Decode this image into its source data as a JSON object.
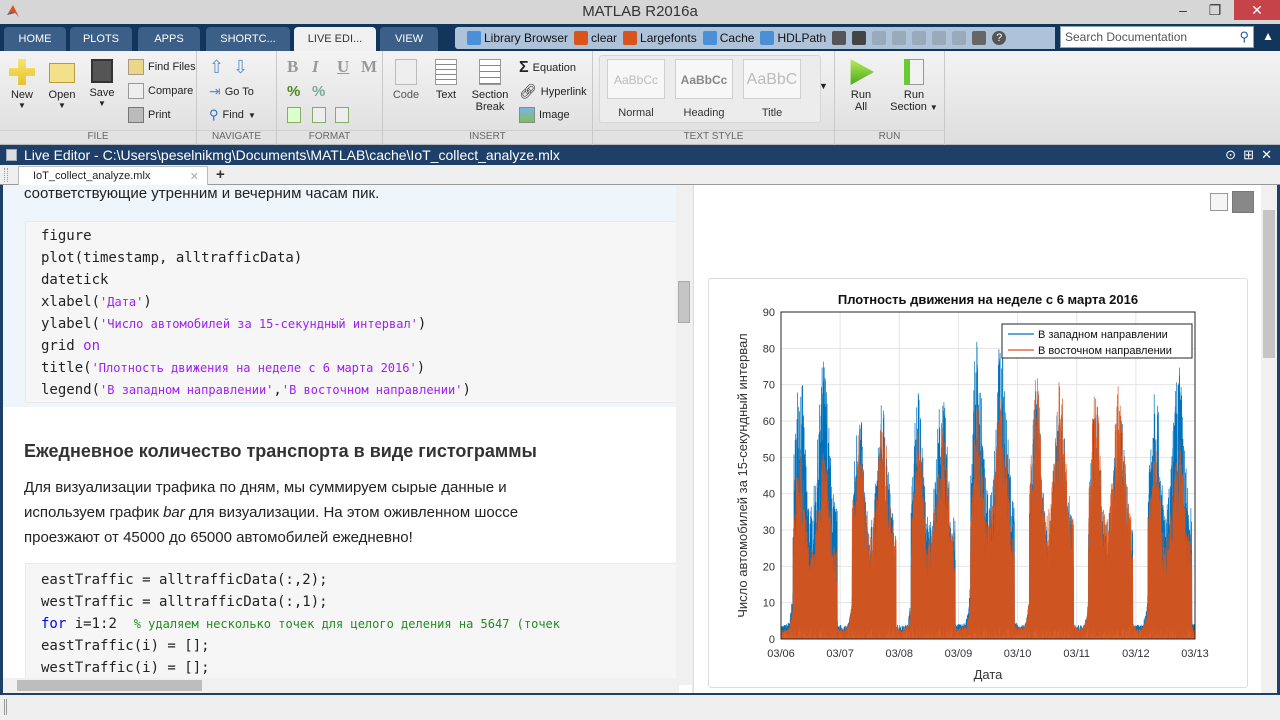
{
  "window": {
    "title": "MATLAB R2016a",
    "minimize": "‒",
    "restore": "❐",
    "close": "✕"
  },
  "tabs": [
    {
      "label": "HOME",
      "active": false
    },
    {
      "label": "PLOTS",
      "active": false
    },
    {
      "label": "APPS",
      "active": false
    },
    {
      "label": "SHORTC...",
      "active": false
    },
    {
      "label": "LIVE EDI...",
      "active": true
    },
    {
      "label": "VIEW",
      "active": false
    }
  ],
  "quick_access": {
    "shortcuts": [
      "Library Browser",
      "clear",
      "Largefonts",
      "Cache",
      "HDLPath"
    ],
    "icons": [
      "new-shortcut-icon",
      "save-icon",
      "cut-icon",
      "copy-icon",
      "paste-icon",
      "undo-icon",
      "redo-icon",
      "switch-windows-icon",
      "help-icon"
    ]
  },
  "search": {
    "placeholder": "Search Documentation"
  },
  "ribbon": {
    "file": {
      "label": "FILE",
      "new": "New",
      "open": "Open",
      "save": "Save",
      "find_files": "Find Files",
      "compare": "Compare",
      "print": "Print"
    },
    "navigate": {
      "label": "NAVIGATE",
      "goto": "Go To",
      "find": "Find"
    },
    "format": {
      "label": "FORMAT",
      "bold": "B",
      "italic": "I",
      "underline": "U",
      "mono": "M"
    },
    "insert": {
      "label": "INSERT",
      "code": "Code",
      "text": "Text",
      "section_break_1": "Section",
      "section_break_2": "Break",
      "equation": "Equation",
      "hyperlink": "Hyperlink",
      "image": "Image"
    },
    "text_style": {
      "label": "TEXT STYLE",
      "styles": [
        {
          "name": "Normal",
          "preview": "AaBbCc"
        },
        {
          "name": "Heading",
          "preview": "AaBbCc"
        },
        {
          "name": "Title",
          "preview": "AaBbC"
        }
      ]
    },
    "run": {
      "label": "RUN",
      "run_all_1": "Run",
      "run_all_2": "All",
      "run_section_1": "Run",
      "run_section_2": "Section"
    }
  },
  "panel": {
    "title": "Live Editor - C:\\Users\\peselnikmg\\Documents\\MATLAB\\cache\\IoT_collect_analyze.mlx"
  },
  "doc_tab": {
    "label": "IoT_collect_analyze.mlx",
    "close": "✕",
    "add": "+"
  },
  "editor": {
    "intro_text": "соответствующие утренним и вечерним часам пик.",
    "code1": {
      "l1": "figure",
      "l2": "plot(timestamp, alltrafficData)",
      "l3": "datetick",
      "l4a": "xlabel(",
      "l4s": "'Дата'",
      "l4b": ")",
      "l5a": "ylabel(",
      "l5s": "'Число автомобилей за 15-секундный интервал'",
      "l5b": ")",
      "l6a": "grid ",
      "l6k": "on",
      "l7a": "title(",
      "l7s": "'Плотность движения на неделе с 6 марта 2016'",
      "l7b": ")",
      "l8a": "legend(",
      "l8s1": "'В западном направлении'",
      "l8c": ",",
      "l8s2": "'В восточном направлении'",
      "l8b": ")"
    },
    "heading": "Ежедневное количество транспорта в виде гистограммы",
    "para1": "Для визуализации трафика по дням, мы суммируем сырые данные и",
    "para2a": "используем график ",
    "para2i": "bar",
    "para2b": " для визуализации. На этом оживленном шоссе",
    "para3": "проезжают от 45000 до 65000 автомобилей ежедневно!",
    "code2": {
      "l1": "eastTraffic = alltrafficData(:,2);",
      "l2": "westTraffic = alltrafficData(:,1);",
      "l3k": "for",
      "l3a": " i=1:2  ",
      "l3c": "% удаляем несколько точек для целого деления на 5647 (точек",
      "l4": "eastTraffic(i) = [];",
      "l5": "westTraffic(i) = [];"
    }
  },
  "chart_data": {
    "type": "line",
    "title": "Плотность движения на неделе с 6 марта 2016",
    "xlabel": "Дата",
    "ylabel": "Число автомобилей за 15-секундный интервал",
    "x_ticks": [
      "03/06",
      "03/07",
      "03/08",
      "03/09",
      "03/10",
      "03/11",
      "03/12",
      "03/13"
    ],
    "y_ticks": [
      0,
      10,
      20,
      30,
      40,
      50,
      60,
      70,
      80,
      90
    ],
    "ylim": [
      0,
      90
    ],
    "xlim_days": [
      0,
      7
    ],
    "grid": true,
    "legend_position": "top-right",
    "series": [
      {
        "name": "В западном направлении",
        "color": "#0072bd",
        "daily_peaks": [
          78,
          66,
          70,
          85,
          69,
          67,
          77
        ],
        "daily_min": 4
      },
      {
        "name": "В восточном направлении",
        "color": "#d95319",
        "daily_peaks": [
          53,
          61,
          59,
          68,
          73,
          71,
          57
        ],
        "daily_min": 0
      }
    ]
  }
}
